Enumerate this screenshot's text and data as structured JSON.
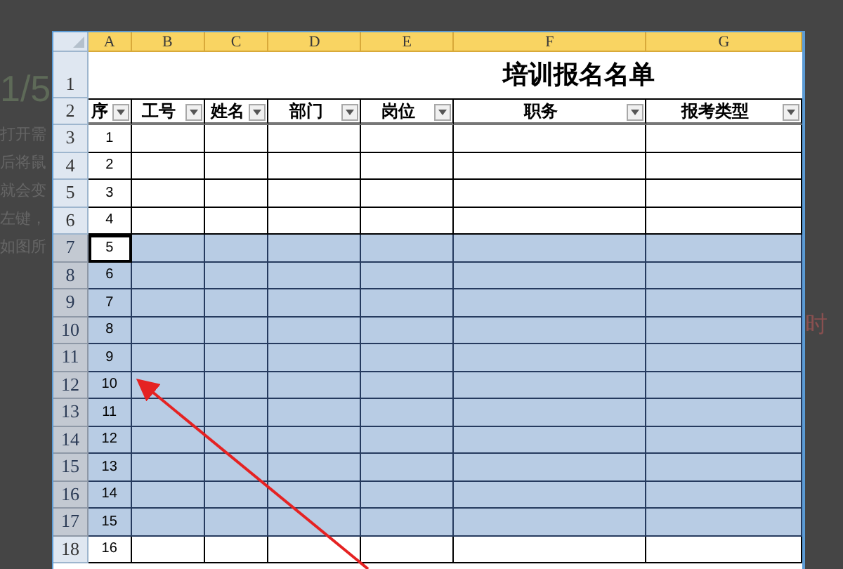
{
  "background_text": {
    "step": "1/5",
    "lines": [
      "打开需",
      "后将鼠",
      "就会变",
      "左键，",
      "如图所"
    ],
    "right_fragment": "时"
  },
  "sheet": {
    "columns": [
      {
        "label": "A",
        "selected": true
      },
      {
        "label": "B",
        "selected": true
      },
      {
        "label": "C",
        "selected": true
      },
      {
        "label": "D",
        "selected": true
      },
      {
        "label": "E",
        "selected": true
      },
      {
        "label": "F",
        "selected": true
      },
      {
        "label": "G",
        "selected": true
      }
    ],
    "title_row": {
      "row": "1",
      "title": "培训报名名单"
    },
    "header_row": {
      "row": "2",
      "headers": [
        {
          "text": "序"
        },
        {
          "text": "工号"
        },
        {
          "text": "姓名"
        },
        {
          "text": "部门"
        },
        {
          "text": "岗位"
        },
        {
          "text": "职务"
        },
        {
          "text": "报考类型"
        }
      ]
    },
    "rows": [
      {
        "row": "3",
        "no": "1",
        "selected": false,
        "active": false
      },
      {
        "row": "4",
        "no": "2",
        "selected": false,
        "active": false
      },
      {
        "row": "5",
        "no": "3",
        "selected": false,
        "active": false
      },
      {
        "row": "6",
        "no": "4",
        "selected": false,
        "active": false
      },
      {
        "row": "7",
        "no": "5",
        "selected": true,
        "active": true
      },
      {
        "row": "8",
        "no": "6",
        "selected": true,
        "active": false
      },
      {
        "row": "9",
        "no": "7",
        "selected": true,
        "active": false
      },
      {
        "row": "10",
        "no": "8",
        "selected": true,
        "active": false
      },
      {
        "row": "11",
        "no": "9",
        "selected": true,
        "active": false
      },
      {
        "row": "12",
        "no": "10",
        "selected": true,
        "active": false
      },
      {
        "row": "13",
        "no": "11",
        "selected": true,
        "active": false
      },
      {
        "row": "14",
        "no": "12",
        "selected": true,
        "active": false
      },
      {
        "row": "15",
        "no": "13",
        "selected": true,
        "active": false
      },
      {
        "row": "16",
        "no": "14",
        "selected": true,
        "active": false
      },
      {
        "row": "17",
        "no": "15",
        "selected": true,
        "active": false
      },
      {
        "row": "18",
        "no": "16",
        "selected": false,
        "active": false
      }
    ]
  }
}
